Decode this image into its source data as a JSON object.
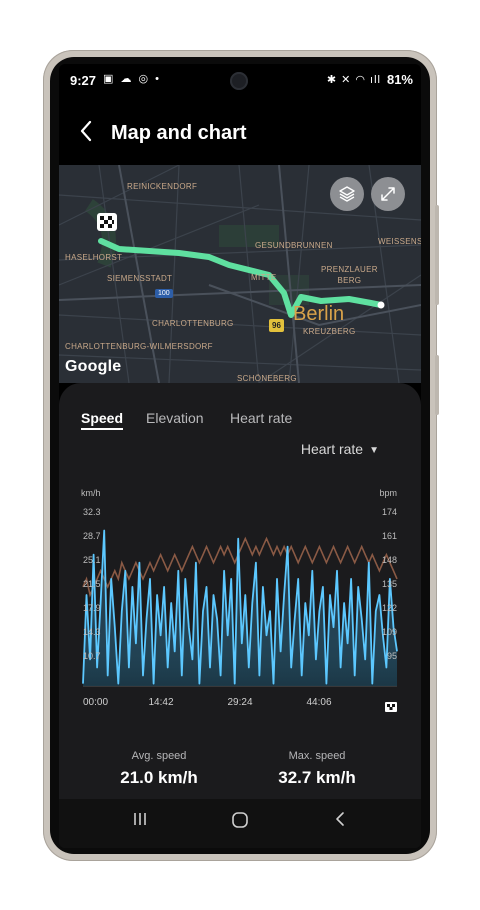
{
  "status_bar": {
    "time": "9:27",
    "left_icons": "▣ ☁ ◎ •",
    "right_icons": "✱ ✕ ◠ ıll",
    "battery": "81%"
  },
  "header": {
    "title": "Map and chart"
  },
  "map": {
    "labels": {
      "reinickendorf": "REINICKENDORF",
      "haselhorst": "HASELHORST",
      "siemensstadt": "SIEMENSSTADT",
      "charlottenburg": "CHARLOTTENBURG",
      "charlottenburg_wilmersdorf": "CHARLOTTENBURG-WILMERSDORF",
      "gesundbrunnen": "GESUNDBRUNNEN",
      "mitte": "MITTE",
      "prenzlauer_berg": "PRENZLAUER\nBERG",
      "weissensee": "WEISSENS",
      "kreuzberg": "KREUZBERG",
      "schoneberg": "SCHÖNEBERG",
      "berlin": "Berlin",
      "road_100": "100",
      "road_96": "96",
      "google": "Google"
    }
  },
  "tabs": [
    {
      "label": "Speed"
    },
    {
      "label": "Elevation"
    },
    {
      "label": "Heart rate"
    }
  ],
  "overlay_select": {
    "value": "Heart rate"
  },
  "colors": {
    "speed": "#5cc8ff",
    "heart_rate": "#8a5a45",
    "route": "#5fe0a0"
  },
  "chart_data": {
    "type": "line",
    "y_left_label": "km/h",
    "y_right_label": "bpm",
    "y_left_ticks": [
      "32.3",
      "28.7",
      "25.1",
      "21.5",
      "17.9",
      "14.3",
      "10.7"
    ],
    "y_right_ticks": [
      "174",
      "161",
      "148",
      "135",
      "122",
      "109",
      "95"
    ],
    "x_ticks": [
      "00:00",
      "14:42",
      "29:24",
      "44:06"
    ],
    "ylim": [
      10.7,
      32.3
    ],
    "series": [
      {
        "name": "Speed",
        "values": [
          11,
          22,
          14,
          27,
          13,
          21,
          30,
          12,
          24,
          18,
          11,
          20,
          25,
          13,
          23,
          16,
          26,
          12,
          19,
          24,
          11,
          22,
          17,
          23,
          13,
          21,
          15,
          25,
          12,
          24,
          18,
          14,
          26,
          11,
          20,
          23,
          13,
          22,
          19,
          12,
          25,
          17,
          24,
          11,
          29,
          16,
          22,
          13,
          21,
          26,
          12,
          23,
          17,
          20,
          11,
          24,
          15,
          22,
          28,
          13,
          19,
          24,
          12,
          21,
          17,
          25,
          14,
          20,
          23,
          11,
          22,
          18,
          25,
          13,
          21,
          16,
          24,
          12,
          23,
          19,
          14,
          26,
          11,
          20,
          22,
          17,
          13,
          24,
          18,
          15
        ]
      },
      {
        "name": "Heart rate",
        "values": [
          23,
          24,
          22,
          23,
          24,
          25,
          24,
          23,
          24,
          25,
          24,
          26,
          25,
          24,
          25,
          26,
          25,
          24,
          25,
          26,
          25,
          26,
          27,
          26,
          25,
          26,
          27,
          26,
          25,
          26,
          27,
          28,
          27,
          26,
          27,
          28,
          27,
          26,
          27,
          28,
          27,
          28,
          27,
          26,
          27,
          28,
          29,
          28,
          27,
          28,
          27,
          28,
          29,
          28,
          27,
          28,
          27,
          28,
          27,
          28,
          27,
          26,
          27,
          28,
          27,
          26,
          27,
          28,
          27,
          26,
          27,
          28,
          27,
          26,
          27,
          28,
          27,
          26,
          27,
          28,
          27,
          26,
          27,
          26,
          25,
          26,
          27,
          26,
          25,
          24
        ]
      }
    ]
  },
  "stats": {
    "avg_label": "Avg. speed",
    "avg_value": "21.0 km/h",
    "max_label": "Max. speed",
    "max_value": "32.7 km/h"
  }
}
